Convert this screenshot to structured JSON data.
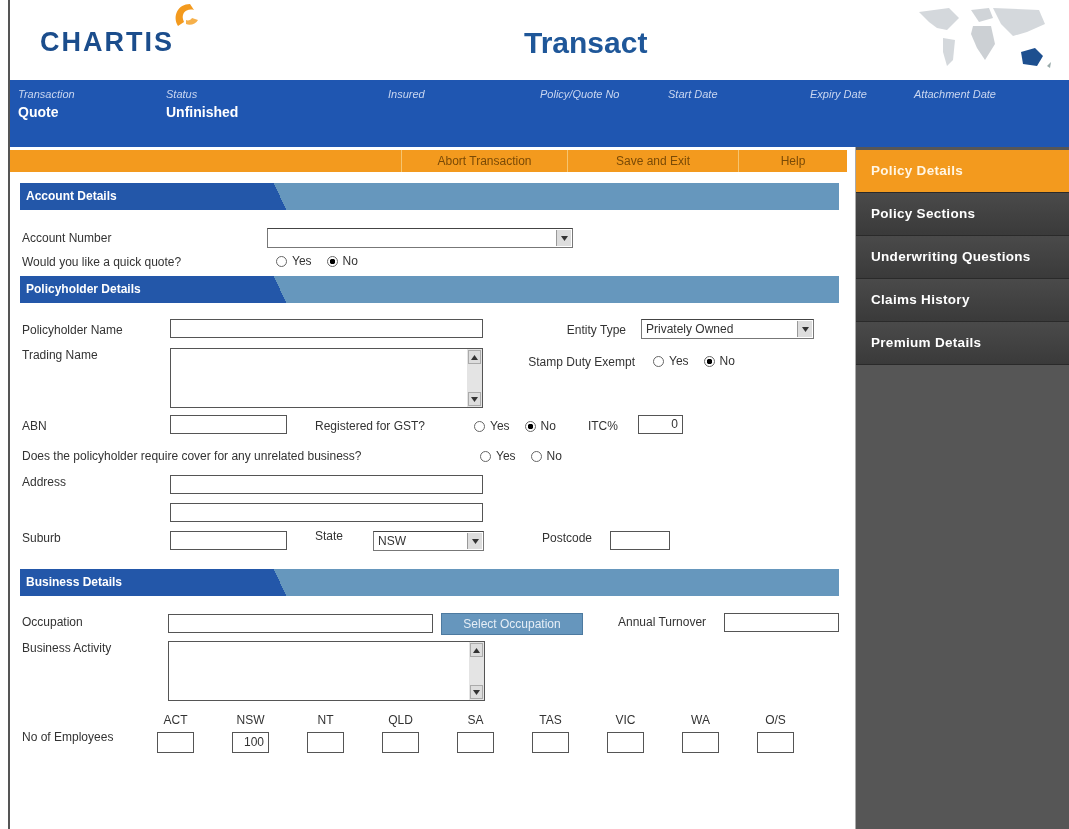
{
  "header": {
    "logo": "CHARTIS",
    "title": "Transact"
  },
  "info_bar": [
    {
      "label": "Transaction",
      "value": "Quote"
    },
    {
      "label": "Status",
      "value": "Unfinished"
    },
    {
      "label": "Insured"
    },
    {
      "label": "Policy/Quote No"
    },
    {
      "label": "Start Date"
    },
    {
      "label": "Expiry Date"
    },
    {
      "label": "Attachment Date"
    }
  ],
  "toolbar": [
    "Abort Transaction",
    "Save and Exit",
    "Help"
  ],
  "sidebar": [
    {
      "label": "Policy Details",
      "selected": true
    },
    {
      "label": "Policy Sections",
      "selected": false
    },
    {
      "label": "Underwriting Questions",
      "selected": false
    },
    {
      "label": "Claims History",
      "selected": false
    },
    {
      "label": "Premium Details",
      "selected": false
    }
  ],
  "account_details": {
    "title": "Account Details",
    "account_number": {
      "label": "Account Number"
    },
    "quick_quote": {
      "label": "Would you like a quick quote?",
      "options": [
        {
          "label": "Yes",
          "selected": false
        },
        {
          "label": "No",
          "selected": true
        }
      ]
    }
  },
  "policyholder_details": {
    "title": "Policyholder Details",
    "policyholder_name": {
      "label": "Policyholder Name"
    },
    "entity_type": {
      "label": "Entity Type",
      "value": "Privately Owned"
    },
    "trading_name": {
      "label": "Trading Name"
    },
    "stamp_duty_exempt": {
      "label": "Stamp Duty Exempt",
      "options": [
        {
          "label": "Yes",
          "selected": false
        },
        {
          "label": "No",
          "selected": true
        }
      ]
    },
    "abn": {
      "label": "ABN"
    },
    "registered_for_gst": {
      "label": "Registered for GST?",
      "options": [
        {
          "label": "Yes",
          "selected": false
        },
        {
          "label": "No",
          "selected": true
        }
      ]
    },
    "itc": {
      "label": "ITC%",
      "value": "0"
    },
    "unrelated_business": {
      "label": "Does the policyholder require cover for any unrelated business?",
      "options": [
        {
          "label": "Yes",
          "selected": false
        },
        {
          "label": "No",
          "selected": false
        }
      ]
    },
    "address": {
      "label": "Address"
    },
    "suburb": {
      "label": "Suburb"
    },
    "state": {
      "label": "State",
      "value": "NSW"
    },
    "postcode": {
      "label": "Postcode"
    }
  },
  "business_details": {
    "title": "Business Details",
    "occupation": {
      "label": "Occupation",
      "button": "Select Occupation"
    },
    "annual_turnover": {
      "label": "Annual Turnover"
    },
    "business_activity": {
      "label": "Business Activity"
    },
    "employees": {
      "label": "No of Employees",
      "states": [
        {
          "label": "ACT"
        },
        {
          "label": "NSW",
          "value": "100"
        },
        {
          "label": "NT"
        },
        {
          "label": "QLD"
        },
        {
          "label": "SA"
        },
        {
          "label": "TAS"
        },
        {
          "label": "VIC"
        },
        {
          "label": "WA"
        },
        {
          "label": "O/S"
        }
      ]
    }
  }
}
